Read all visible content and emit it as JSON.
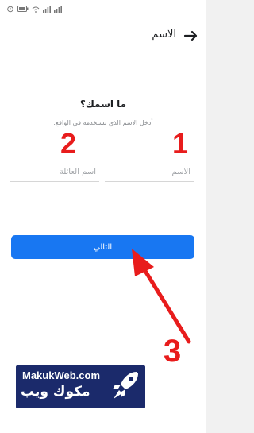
{
  "header": {
    "title": "الاسم",
    "back_icon": "arrow-back-icon"
  },
  "form": {
    "question": "ما اسمك؟",
    "subtext": "أدخل الاسم الذي تستخدمه في الواقع.",
    "first_name_placeholder": "الاسم",
    "last_name_placeholder": "اسم العائلة",
    "first_name_value": "",
    "last_name_value": ""
  },
  "next_button": {
    "label": "التالي"
  },
  "annotations": {
    "num1": "1",
    "num2": "2",
    "num3": "3"
  },
  "logo": {
    "en": "MakukWeb.com",
    "ar": "مكوك ويب"
  },
  "colors": {
    "primary": "#1877f2",
    "annotation": "#e81c1c",
    "logo_bg": "#1b2a6b"
  }
}
